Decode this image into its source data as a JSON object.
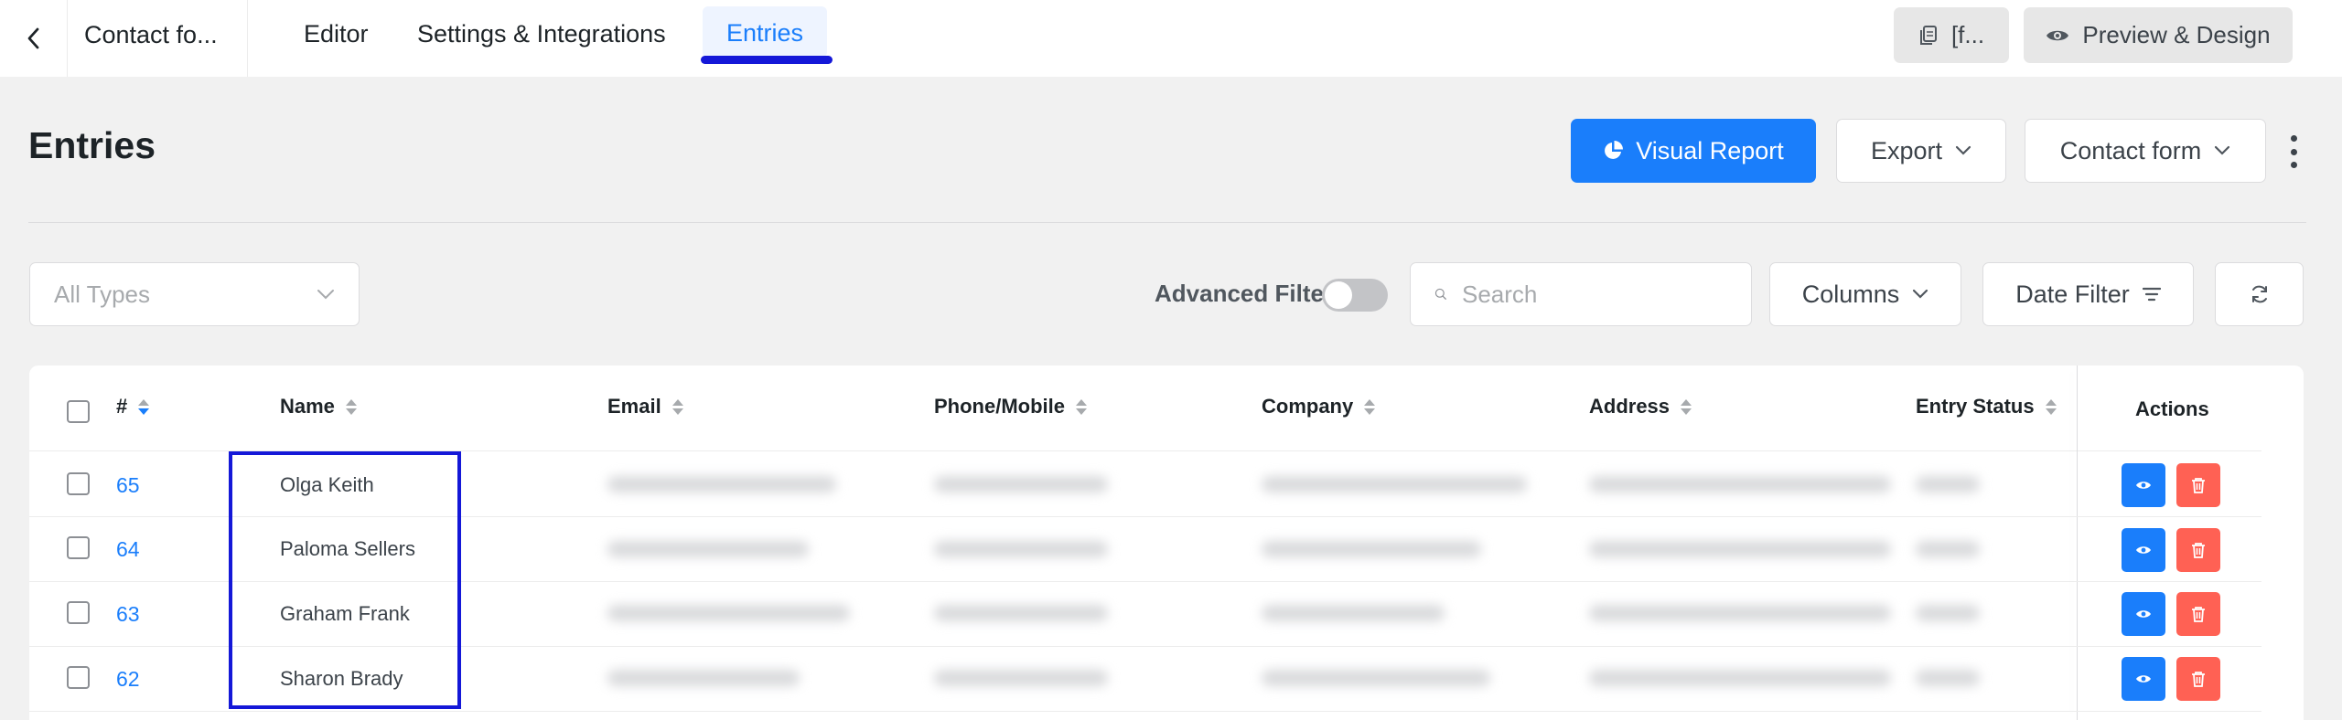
{
  "topbar": {
    "form_title": "Contact fo...",
    "tabs": [
      {
        "label": "Editor"
      },
      {
        "label": "Settings & Integrations"
      },
      {
        "label": "Entries"
      }
    ],
    "shortcode_label": "[f...",
    "preview_label": "Preview & Design"
  },
  "header": {
    "title": "Entries",
    "visual_report_label": "Visual Report",
    "export_label": "Export",
    "form_select_label": "Contact form"
  },
  "filters": {
    "type_select": "All Types",
    "advanced_filter_label": "Advanced Filter",
    "advanced_filter_on": false,
    "search_placeholder": "Search",
    "columns_label": "Columns",
    "date_filter_label": "Date Filter"
  },
  "table": {
    "columns": [
      "#",
      "Name",
      "Email",
      "Phone/Mobile",
      "Company",
      "Address",
      "Entry Status",
      "Actions"
    ],
    "rows": [
      {
        "id": "65",
        "name": "Olga Keith"
      },
      {
        "id": "64",
        "name": "Paloma Sellers"
      },
      {
        "id": "63",
        "name": "Graham Frank"
      },
      {
        "id": "62",
        "name": "Sharon Brady"
      }
    ]
  },
  "colors": {
    "primary": "#1a7efb",
    "danger": "#ff6154",
    "highlight": "#1418d8"
  },
  "icons": [
    "chevron-left-icon",
    "copy-icon",
    "eye-icon",
    "pie-chart-icon",
    "chevron-down-icon",
    "more-vertical-icon",
    "search-icon",
    "filter-lines-icon",
    "refresh-icon",
    "trash-icon"
  ]
}
